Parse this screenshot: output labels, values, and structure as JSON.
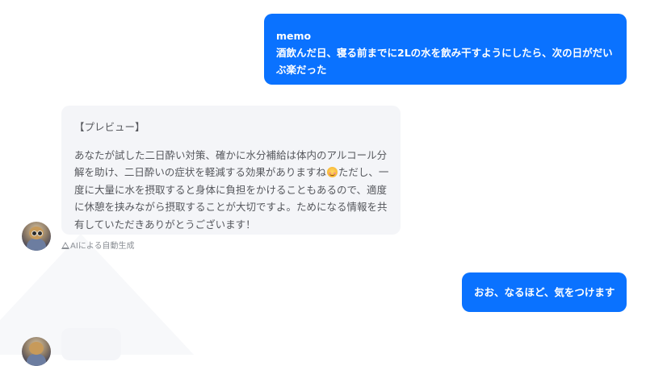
{
  "messages": {
    "user_memo": {
      "title": "memo",
      "body": "酒飲んだ日、寝る前までに2Lの水を飲み干すようにしたら、次の日がだいぶ楽だった"
    },
    "ai_preview": {
      "heading": "【プレビュー】",
      "body_before_emoji": "あなたが試した二日酔い対策、確かに水分補給は体内のアルコール分解を助け、二日酔いの症状を軽減する効果がありますね",
      "emoji_icon": "smiling-face-icon",
      "body_after_emoji": "ただし、一度に大量に水を摂取すると身体に負担をかけることもあるので、適度に休憩を挟みながら摂取することが大切ですよ。ためになる情報を共有していただきありがとうございます！",
      "note": "AIによる自動生成",
      "note_icon": "warning-triangle-icon"
    },
    "user_reply": {
      "body": "おお、なるほど、気をつけます"
    }
  },
  "colors": {
    "user_bubble": "#0a72ff",
    "ai_bubble": "#f4f5f8",
    "ai_text": "#55575c",
    "note_text": "#8c9096"
  }
}
